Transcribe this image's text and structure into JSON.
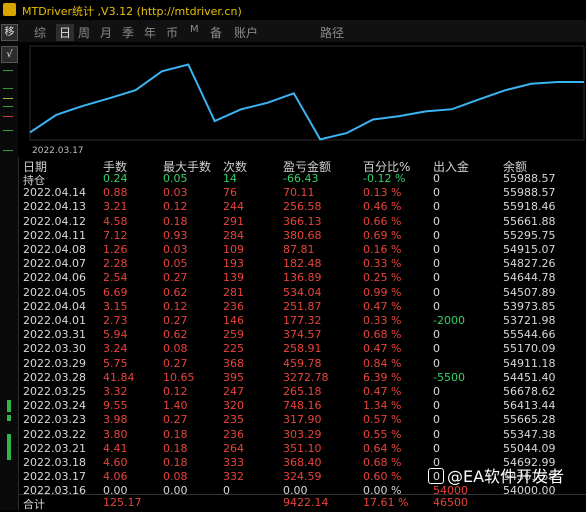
{
  "window": {
    "title": "MTDriver统计 ,V3.12 (http://mtdriver.cn)"
  },
  "left_strip": {
    "btn_a": "移",
    "btn_b": "√"
  },
  "tabs": [
    {
      "label": "综",
      "active": false
    },
    {
      "label": "日",
      "active": true
    },
    {
      "label": "周",
      "active": false
    },
    {
      "label": "月",
      "active": false
    },
    {
      "label": "季",
      "active": false
    },
    {
      "label": "年",
      "active": false
    },
    {
      "label": "币",
      "active": false
    },
    {
      "label": "M",
      "active": false
    },
    {
      "label": "备",
      "active": false
    },
    {
      "label": "账户",
      "active": false
    },
    {
      "label": "路径",
      "active": false
    }
  ],
  "chart_data": {
    "type": "line",
    "x_label": "2022.03.17",
    "series": [
      {
        "values": [
          54000,
          54692.99,
          55044.09,
          55347.38,
          55665.28,
          56413.44,
          56678.62,
          54451.4,
          54911.18,
          55170.09,
          55544.66,
          53721.98,
          53973.85,
          54507.89,
          54644.78,
          54827.26,
          54915.07,
          55295.75,
          55661.88,
          55918.46,
          55988.57,
          55988.57
        ]
      }
    ],
    "line_color": "#3ab4f2"
  },
  "table": {
    "headers": [
      "日期",
      "手数",
      "最大手数",
      "次数",
      "盈亏金额",
      "百分比%",
      "出入金",
      "余额"
    ],
    "rows": [
      {
        "c": [
          "持仓",
          "0.24",
          "0.05",
          "14",
          "-66.43",
          "-0.12 %",
          "0",
          "55988.57"
        ],
        "hold": true
      },
      {
        "c": [
          "2022.04.14",
          "0.88",
          "0.03",
          "76",
          "70.11",
          "0.13 %",
          "0",
          "55988.57"
        ]
      },
      {
        "c": [
          "2022.04.13",
          "3.21",
          "0.12",
          "244",
          "256.58",
          "0.46 %",
          "0",
          "55918.46"
        ]
      },
      {
        "c": [
          "2022.04.12",
          "4.58",
          "0.18",
          "291",
          "366.13",
          "0.66 %",
          "0",
          "55661.88"
        ]
      },
      {
        "c": [
          "2022.04.11",
          "7.12",
          "0.93",
          "284",
          "380.68",
          "0.69 %",
          "0",
          "55295.75"
        ]
      },
      {
        "c": [
          "2022.04.08",
          "1.26",
          "0.03",
          "109",
          "87.81",
          "0.16 %",
          "0",
          "54915.07"
        ]
      },
      {
        "c": [
          "2022.04.07",
          "2.28",
          "0.05",
          "193",
          "182.48",
          "0.33 %",
          "0",
          "54827.26"
        ]
      },
      {
        "c": [
          "2022.04.06",
          "2.54",
          "0.27",
          "139",
          "136.89",
          "0.25 %",
          "0",
          "54644.78"
        ]
      },
      {
        "c": [
          "2022.04.05",
          "6.69",
          "0.62",
          "281",
          "534.04",
          "0.99 %",
          "0",
          "54507.89"
        ]
      },
      {
        "c": [
          "2022.04.04",
          "3.15",
          "0.12",
          "236",
          "251.87",
          "0.47 %",
          "0",
          "53973.85"
        ]
      },
      {
        "c": [
          "2022.04.01",
          "2.73",
          "0.27",
          "146",
          "177.32",
          "0.33 %",
          "-2000",
          "53721.98"
        ],
        "inout_green": true
      },
      {
        "c": [
          "2022.03.31",
          "5.94",
          "0.62",
          "259",
          "374.57",
          "0.68 %",
          "0",
          "55544.66"
        ]
      },
      {
        "c": [
          "2022.03.30",
          "3.24",
          "0.08",
          "225",
          "258.91",
          "0.47 %",
          "0",
          "55170.09"
        ]
      },
      {
        "c": [
          "2022.03.29",
          "5.75",
          "0.27",
          "368",
          "459.78",
          "0.84 %",
          "0",
          "54911.18"
        ]
      },
      {
        "c": [
          "2022.03.28",
          "41.84",
          "10.65",
          "395",
          "3272.78",
          "6.39 %",
          "-5500",
          "54451.40"
        ],
        "inout_green": true
      },
      {
        "c": [
          "2022.03.25",
          "3.32",
          "0.12",
          "247",
          "265.18",
          "0.47 %",
          "0",
          "56678.62"
        ]
      },
      {
        "c": [
          "2022.03.24",
          "9.55",
          "1.40",
          "320",
          "748.16",
          "1.34 %",
          "0",
          "56413.44"
        ]
      },
      {
        "c": [
          "2022.03.23",
          "3.98",
          "0.27",
          "235",
          "317.90",
          "0.57 %",
          "0",
          "55665.28"
        ]
      },
      {
        "c": [
          "2022.03.22",
          "3.80",
          "0.18",
          "236",
          "303.29",
          "0.55 %",
          "0",
          "55347.38"
        ]
      },
      {
        "c": [
          "2022.03.21",
          "4.41",
          "0.18",
          "264",
          "351.10",
          "0.64 %",
          "0",
          "55044.09"
        ]
      },
      {
        "c": [
          "2022.03.18",
          "4.60",
          "0.18",
          "333",
          "368.40",
          "0.68 %",
          "0",
          "54692.99"
        ]
      },
      {
        "c": [
          "2022.03.17",
          "4.06",
          "0.08",
          "332",
          "324.59",
          "0.60 %",
          "0",
          "54361.59"
        ]
      },
      {
        "c": [
          "2022.03.16",
          "0.00",
          "0.00",
          "0",
          "0.00",
          "0.00 %",
          "54000",
          "54000.00"
        ],
        "first": true
      }
    ],
    "total": [
      "合计",
      "125.17",
      "",
      "",
      "9422.14",
      "17.61 %",
      "46500",
      ""
    ]
  },
  "watermark": "@EA软件开发者",
  "colors": {
    "red": "#e8433b",
    "green": "#35d06a",
    "white": "#d8d8d8",
    "yellow": "#e8c000"
  }
}
